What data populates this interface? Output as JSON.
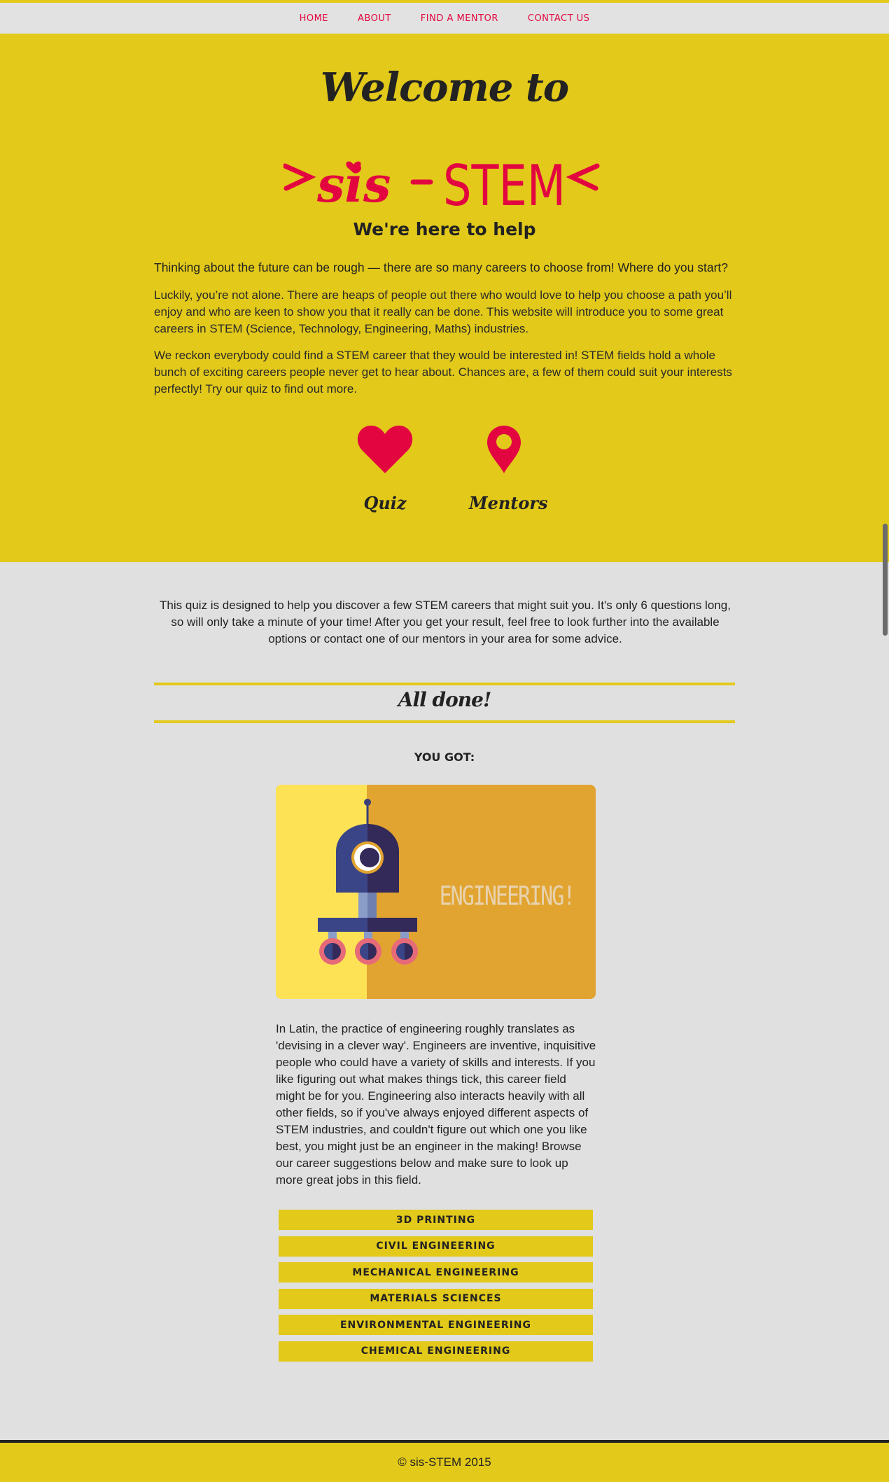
{
  "nav": {
    "items": [
      {
        "label": "HOME"
      },
      {
        "label": "ABOUT"
      },
      {
        "label": "FIND A MENTOR"
      },
      {
        "label": "CONTACT US"
      }
    ]
  },
  "hero": {
    "welcome": "Welcome to",
    "logo_text_left": "sis",
    "logo_text_right": "STEM",
    "heading": "We're here to help",
    "lead": "Thinking about the future can be rough — there are so many careers to choose from! Where do you start?",
    "para1": "Luckily, you’re not alone. There are heaps of people out there who would love to help you choose a path you’ll enjoy and who are keen to show you that it really can be done. This website will introduce you to some great careers in STEM (Science, Technology, Engineering, Maths) industries.",
    "para2": "We reckon everybody could find a STEM career that they would be interested in! STEM fields hold a whole bunch of exciting careers people never get to hear about. Chances are, a few of them could suit your interests perfectly! Try our quiz to find out more.",
    "links": [
      {
        "label": "Quiz",
        "icon": "heart-icon"
      },
      {
        "label": "Mentors",
        "icon": "map-pin-icon"
      }
    ]
  },
  "quiz": {
    "intro": "This quiz is designed to help you discover a few STEM careers that might suit you. It's only 6 questions long, so will only take a minute of your time! After you get your result, feel free to look further into the available options or contact one of our mentors in your area for some advice.",
    "done_title": "All done!",
    "you_got": "YOU GOT:",
    "result_label": "ENGINEERING!",
    "description": "In Latin, the practice of engineering roughly translates as 'devising in a clever way'. Engineers are inventive, inquisitive people who could have a variety of skills and interests. If you like figuring out what makes things tick, this career field might be for you. Engineering also interacts heavily with all other fields, so if you've always enjoyed different aspects of STEM industries, and couldn't figure out which one you like best, you might just be an engineer in the making! Browse our career suggestions below and make sure to look up more great jobs in this field.",
    "careers": [
      {
        "label": "3D PRINTING"
      },
      {
        "label": "CIVIL ENGINEERING"
      },
      {
        "label": "MECHANICAL ENGINEERING"
      },
      {
        "label": "MATERIALS SCIENCES"
      },
      {
        "label": "ENVIRONMENTAL ENGINEERING"
      },
      {
        "label": "CHEMICAL ENGINEERING"
      }
    ]
  },
  "footer": {
    "text": "© sis-STEM 2015"
  },
  "colors": {
    "accent": "#e2c91a",
    "brand": "#e3053f",
    "background": "#e0e0e0",
    "text": "#222222"
  }
}
